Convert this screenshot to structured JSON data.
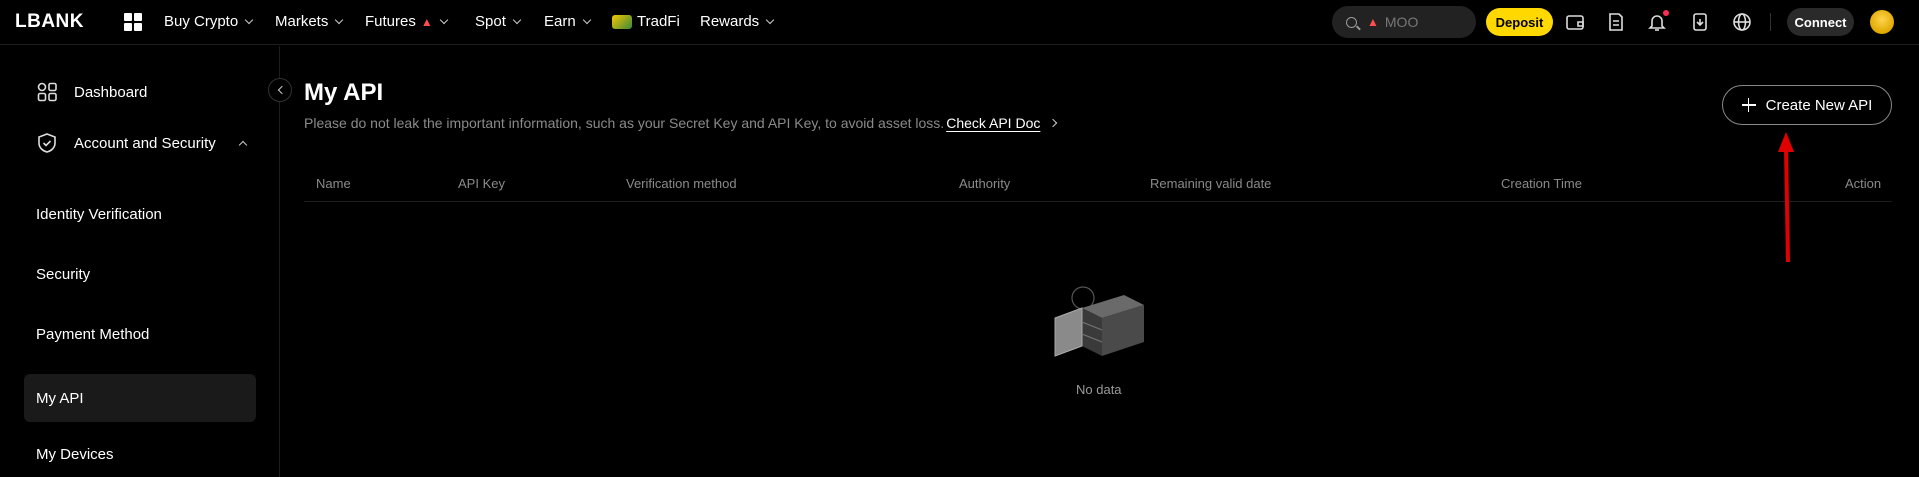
{
  "nav": {
    "logo": "LBANK",
    "items": [
      {
        "label": "Buy Crypto",
        "dropdown": true
      },
      {
        "label": "Markets",
        "dropdown": true
      },
      {
        "label": "Futures",
        "dropdown": true,
        "hot": true
      },
      {
        "label": "Spot",
        "dropdown": true
      },
      {
        "label": "Earn",
        "dropdown": true
      },
      {
        "label": "TradFi",
        "dropdown": false
      },
      {
        "label": "Rewards",
        "dropdown": true
      }
    ],
    "search_placeholder": "MOO",
    "deposit_label": "Deposit",
    "connect_label": "Connect",
    "icons": [
      "wallet-icon",
      "orders-icon",
      "bell-icon",
      "download-icon",
      "globe-icon"
    ]
  },
  "sidebar": {
    "dashboard": "Dashboard",
    "account_security": "Account and Security",
    "sub_items": [
      {
        "label": "Identity Verification"
      },
      {
        "label": "Security"
      },
      {
        "label": "Payment Method"
      },
      {
        "label": "My API",
        "active": true
      },
      {
        "label": "My Devices"
      }
    ]
  },
  "main": {
    "title": "My API",
    "notice": "Please do not leak the important information, such as your Secret Key and API Key, to avoid asset loss.",
    "doc_link": "Check API Doc",
    "create_button": "Create New API",
    "columns": [
      "Name",
      "API Key",
      "Verification method",
      "Authority",
      "Remaining valid date",
      "Creation Time",
      "Action"
    ],
    "rows": [],
    "empty_text": "No data"
  },
  "colors": {
    "background": "#000000",
    "accent": "#ffd800",
    "annotation_arrow": "#e00000"
  }
}
